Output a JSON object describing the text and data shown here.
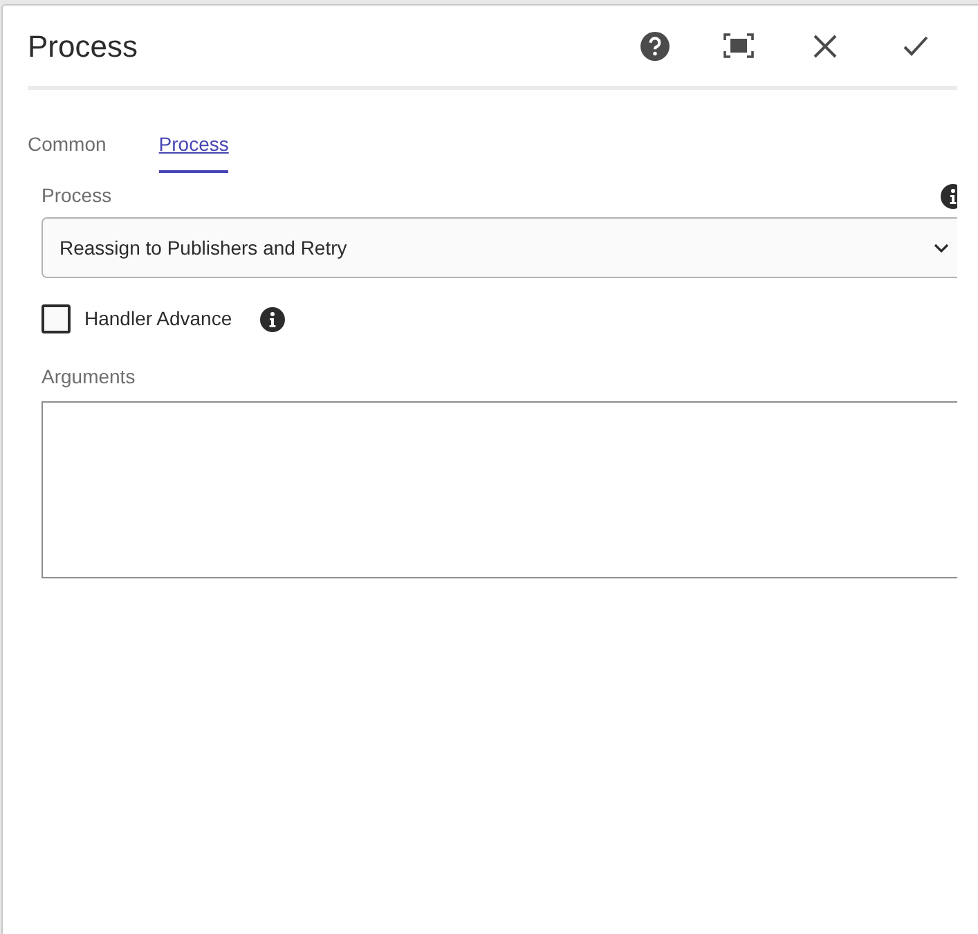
{
  "dialog": {
    "title": "Process"
  },
  "tabs": [
    {
      "label": "Common",
      "selected": false
    },
    {
      "label": "Process",
      "selected": true
    }
  ],
  "process_field": {
    "label": "Process",
    "value": "Reassign to Publishers and Retry"
  },
  "handler_advance": {
    "label": "Handler Advance",
    "checked": false
  },
  "arguments_field": {
    "label": "Arguments"
  }
}
